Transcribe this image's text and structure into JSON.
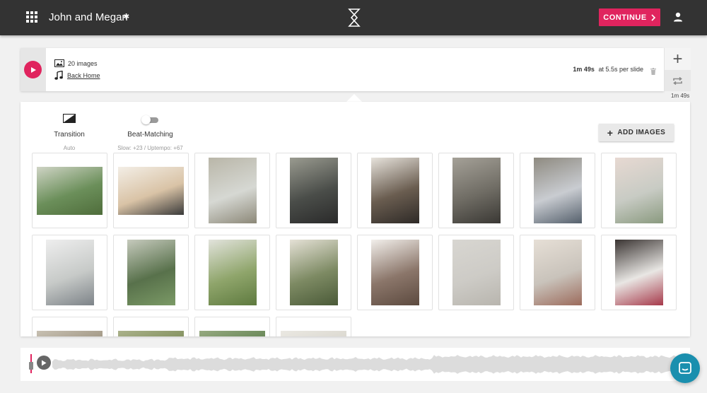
{
  "header": {
    "project_title": "John and Megan",
    "continue_label": "CONTINUE",
    "accent_color": "#e0245e"
  },
  "slideshow": {
    "image_count": "20 images",
    "song": "Back Home",
    "duration": "1m 49s",
    "per_slide": "at 5.5s per slide",
    "total_time": "1m 49s"
  },
  "controls": {
    "transition_label": "Transition",
    "transition_value": "Auto",
    "beat_label": "Beat-Matching",
    "beat_value": "Slow: +23 / Uptempo: +67",
    "beat_enabled": false,
    "add_images_label": "ADD IMAGES"
  },
  "images": [
    {
      "name": "photo-1",
      "orientation": "landscape",
      "colors": [
        "#6b8f5a",
        "#cfd4c5",
        "#4f6d3b"
      ]
    },
    {
      "name": "photo-2",
      "orientation": "landscape",
      "colors": [
        "#d9c3a6",
        "#f3eee6",
        "#3a3a3a"
      ]
    },
    {
      "name": "photo-3",
      "orientation": "portrait",
      "colors": [
        "#d6d8d3",
        "#b9b6a8",
        "#8c8878"
      ]
    },
    {
      "name": "photo-4",
      "orientation": "portrait",
      "colors": [
        "#4a4d49",
        "#9a9b90",
        "#2a2a2a"
      ]
    },
    {
      "name": "photo-5",
      "orientation": "portrait",
      "colors": [
        "#6a5d50",
        "#e7e3dc",
        "#2e2a27"
      ]
    },
    {
      "name": "photo-6",
      "orientation": "portrait",
      "colors": [
        "#6f6c64",
        "#a5a198",
        "#3a3834"
      ]
    },
    {
      "name": "photo-7",
      "orientation": "portrait",
      "colors": [
        "#c9ccd1",
        "#8e8a80",
        "#55606c"
      ]
    },
    {
      "name": "photo-8",
      "orientation": "portrait",
      "colors": [
        "#c8cbc4",
        "#e7d9d2",
        "#8a9a7f"
      ]
    },
    {
      "name": "photo-9",
      "orientation": "portrait",
      "colors": [
        "#c7cac8",
        "#eeeeee",
        "#7d8388"
      ]
    },
    {
      "name": "photo-10",
      "orientation": "portrait",
      "colors": [
        "#58714b",
        "#c6cabd",
        "#7b9a66"
      ]
    },
    {
      "name": "photo-11",
      "orientation": "portrait",
      "colors": [
        "#8fa56b",
        "#e2e3dc",
        "#5e7a3f"
      ]
    },
    {
      "name": "photo-12",
      "orientation": "portrait",
      "colors": [
        "#7d8a63",
        "#e5e1d6",
        "#4a5a38"
      ]
    },
    {
      "name": "photo-13",
      "orientation": "portrait",
      "colors": [
        "#8b766a",
        "#f2efeb",
        "#5c4a3f"
      ]
    },
    {
      "name": "photo-14",
      "orientation": "portrait",
      "colors": [
        "#cdcbc6",
        "#d8d6d1",
        "#b8b5ae"
      ]
    },
    {
      "name": "photo-15",
      "orientation": "portrait",
      "colors": [
        "#c9c3bb",
        "#e6dfd6",
        "#9c6b5c"
      ]
    },
    {
      "name": "photo-16",
      "orientation": "portrait",
      "colors": [
        "#e9e7e4",
        "#3a3432",
        "#a6394a"
      ]
    },
    {
      "name": "photo-17",
      "orientation": "landscape",
      "colors": [
        "#9a8f7b",
        "#c7c0b2",
        "#5b4d3e"
      ]
    },
    {
      "name": "photo-18",
      "orientation": "landscape",
      "colors": [
        "#7b8a55",
        "#aab18a",
        "#4d5a30"
      ]
    },
    {
      "name": "photo-19",
      "orientation": "landscape",
      "colors": [
        "#5d7f4d",
        "#96a980",
        "#3f5a33"
      ]
    },
    {
      "name": "photo-20",
      "orientation": "landscape",
      "colors": [
        "#d8d5cc",
        "#eae8e2",
        "#c4c0b5"
      ]
    }
  ],
  "icons": {
    "apps": "grid-icon",
    "settings": "gear-icon",
    "logo": "hourglass-logo",
    "user": "user-icon",
    "images": "image-icon",
    "music": "music-note-icon",
    "trash": "trash-icon",
    "add": "plus-icon",
    "repeat": "repeat-icon",
    "chat": "chat-icon"
  }
}
